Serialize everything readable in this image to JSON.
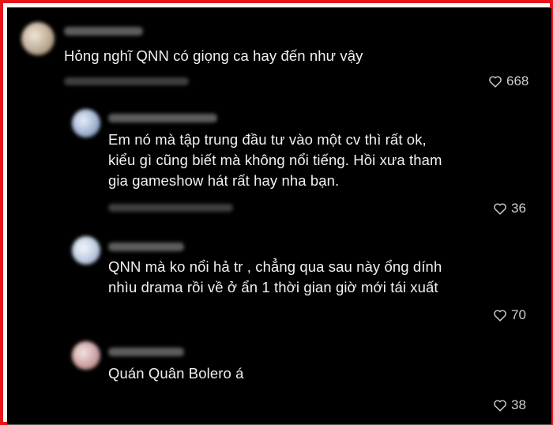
{
  "comments": [
    {
      "text": "Hỏng nghĩ QNN có giọng ca hay đến như vậy",
      "likes": "668",
      "avatar_color": "#d8c7b5"
    },
    {
      "text": "Em nó mà tập trung đầu tư vào một cv thì rất ok,\nkiểu gì cũng biết mà không nổi tiếng. Hồi xưa tham\ngia gameshow hát rất hay nha bạn.",
      "likes": "36",
      "avatar_color": "#aebfda"
    },
    {
      "text": "QNN mà ko nổi hả tr , chẳng qua sau này ổng dính\nnhìu drama rồi về ở ẩn 1 thời gian giờ mới tái xuất",
      "likes": "70",
      "avatar_color": "#c9d6e8"
    },
    {
      "text": "Quán Quân Bolero á",
      "likes": "38",
      "avatar_color": "#e2c4c4"
    }
  ],
  "icons": {
    "like": "heart-outline-icon"
  },
  "colors": {
    "frame_border": "#e8141b",
    "background": "#000000",
    "text": "#f1f1f1"
  }
}
